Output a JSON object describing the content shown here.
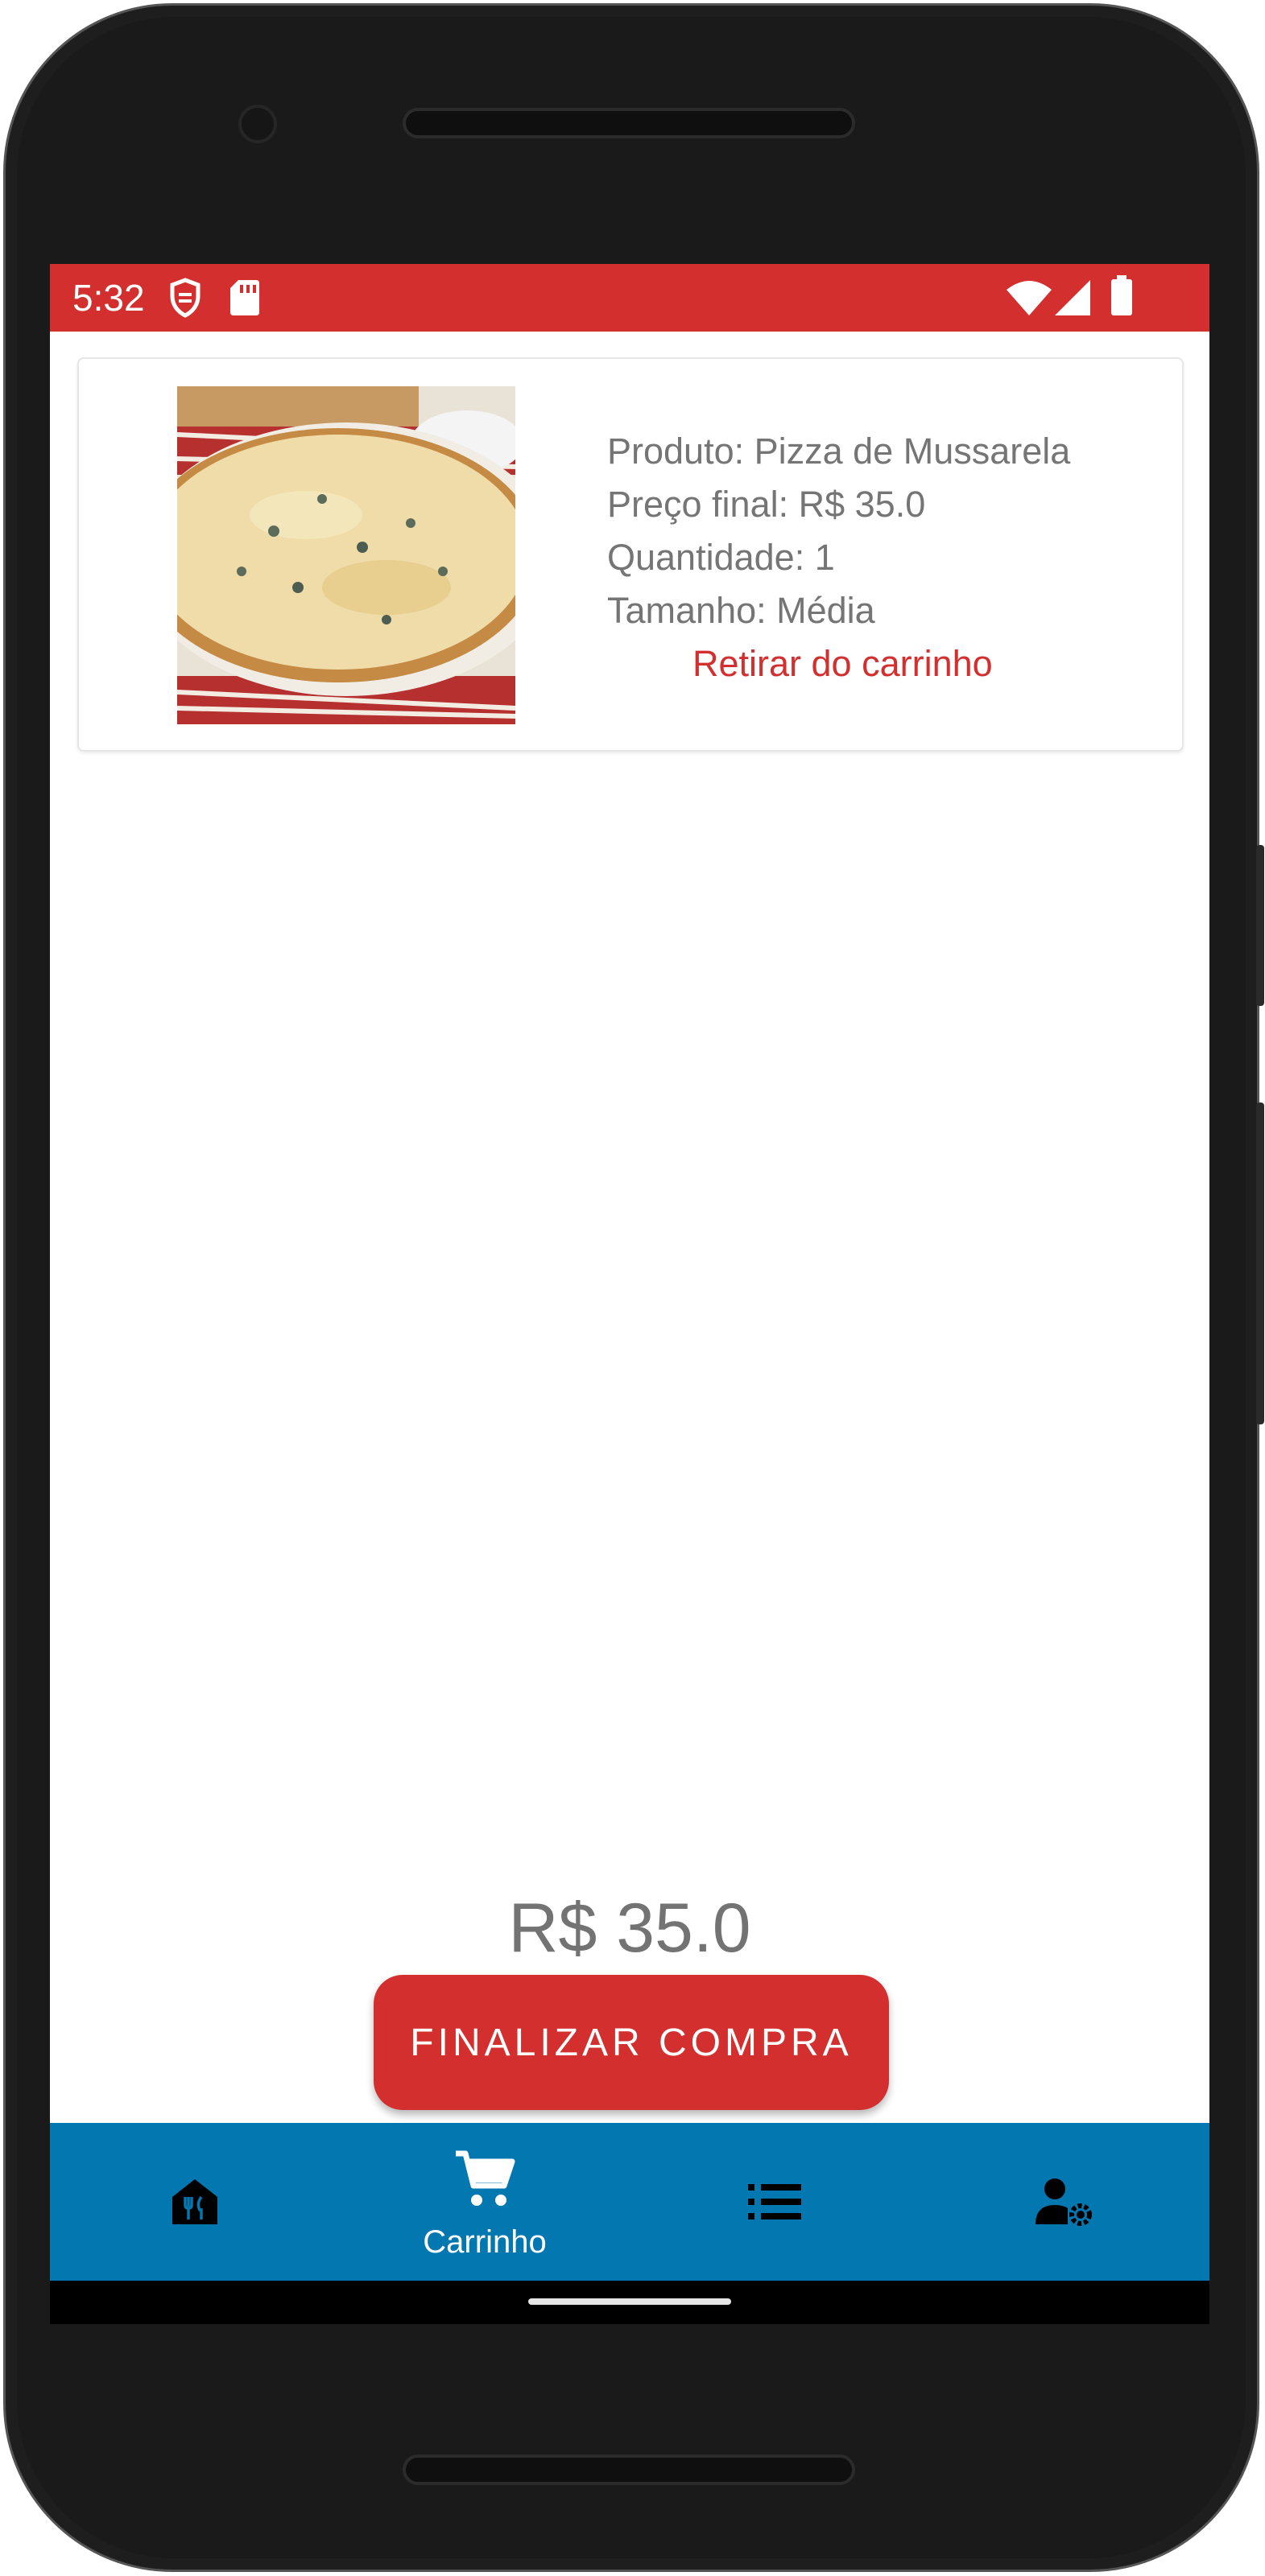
{
  "status_bar": {
    "time": "5:32",
    "icons": [
      "shield-icon",
      "sd-card-icon",
      "wifi-icon",
      "signal-icon",
      "battery-icon"
    ]
  },
  "cart": {
    "items": [
      {
        "product_line": "Produto: Pizza de Mussarela",
        "price_line": "Preço final: R$ 35.0",
        "quantity_line": "Quantidade: 1",
        "size_line": "Tamanho: Média",
        "remove_label": "Retirar do carrinho",
        "image": "pizza-photo"
      }
    ],
    "total": "R$ 35.0",
    "checkout_label": "FINALIZAR COMPRA"
  },
  "bottom_nav": {
    "items": [
      {
        "icon": "restaurant-home-icon",
        "label": ""
      },
      {
        "icon": "cart-icon",
        "label": "Carrinho",
        "active": true
      },
      {
        "icon": "list-icon",
        "label": ""
      },
      {
        "icon": "user-settings-icon",
        "label": ""
      }
    ]
  },
  "colors": {
    "primary": "#d32f2f",
    "nav": "#0277b0",
    "text": "#757575"
  }
}
